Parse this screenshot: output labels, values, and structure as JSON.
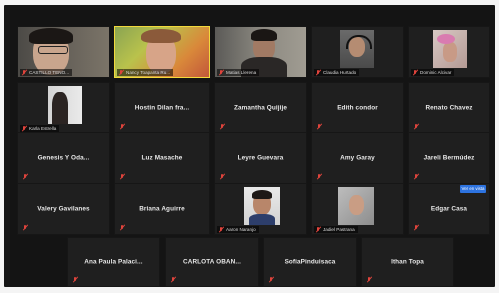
{
  "participants_row1": [
    {
      "label": "CASTILLO TENO...",
      "video": true
    },
    {
      "label": "Nancy Toapanta Ru...",
      "video": true,
      "active": true
    },
    {
      "label": "Matias Llerena",
      "video": true
    },
    {
      "label": "Claudia Hurtado",
      "video": true
    },
    {
      "label": "Dominic Alcivar",
      "video": true
    }
  ],
  "participants_row2": [
    {
      "label": "Karla Estrella",
      "video": true
    },
    {
      "name": "Hostin Dilan fra..."
    },
    {
      "name": "Zamantha Quijije"
    },
    {
      "name": "Edith condor"
    },
    {
      "name": "Renato Chavez"
    }
  ],
  "participants_row3": [
    {
      "name": "Genesis Y Oda..."
    },
    {
      "name": "Luz Masache"
    },
    {
      "name": "Leyre Guevara"
    },
    {
      "name": "Amy Garay"
    },
    {
      "name": "Jareli Bermúdez"
    }
  ],
  "participants_row4": [
    {
      "name": "Valery Gavilanes"
    },
    {
      "name": "Briana Aguirre"
    },
    {
      "label": "Aaron Naranjo",
      "video": true
    },
    {
      "label": "Jadiel Pastrana",
      "video": true
    },
    {
      "name": "Edgar Casa"
    }
  ],
  "participants_row5": [
    {
      "name": "Ana Paula Palaci..."
    },
    {
      "name": "CARLOTA OBAN..."
    },
    {
      "name": "SofiaPinduisaca"
    },
    {
      "name": "Ithan Topa"
    }
  ],
  "view_button": {
    "label": "Ver en vista"
  },
  "colors": {
    "muted_mic": "#e0443c",
    "active_speaker": "#f2d93c",
    "tile": "#1f1f1f"
  }
}
